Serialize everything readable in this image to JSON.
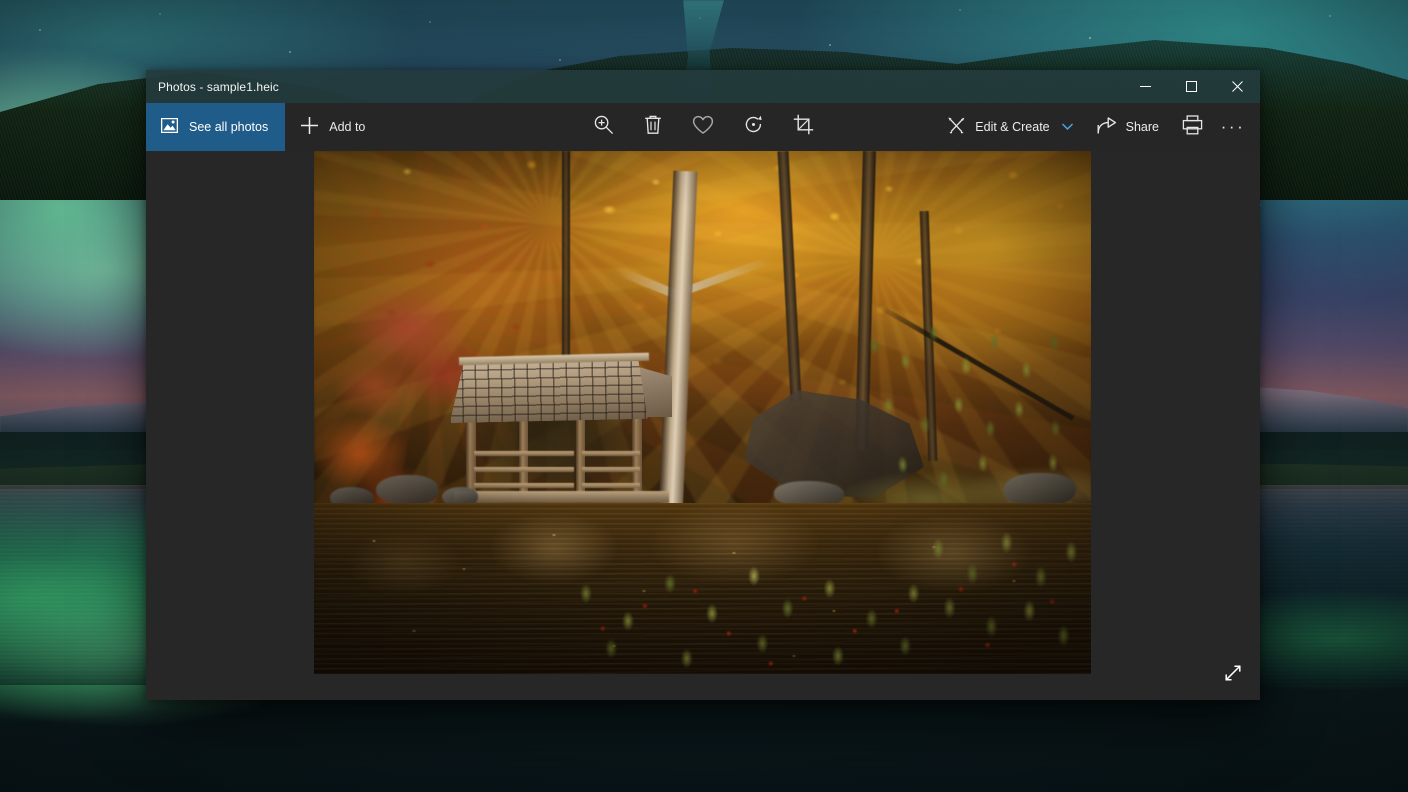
{
  "window": {
    "title": "Photos - sample1.heic",
    "app_name": "Photos",
    "file_name": "sample1.heic",
    "controls": {
      "minimize": "minimize-button",
      "maximize": "maximize-button",
      "close": "close-button"
    }
  },
  "toolbar": {
    "see_all_photos": "See all photos",
    "add_to": "Add to",
    "zoom": "Zoom",
    "delete": "Delete",
    "favorite": "Add to favorites",
    "rotate": "Rotate",
    "crop": "Crop & rotate",
    "edit_create": "Edit & Create",
    "share": "Share",
    "print": "Print",
    "more": "See more",
    "more_glyph": "···",
    "icons": {
      "see_all_photos": "photo-icon",
      "add_to": "plus-icon",
      "zoom": "magnifier-plus-icon",
      "delete": "trash-icon",
      "favorite": "heart-icon",
      "rotate": "rotate-icon",
      "crop": "crop-icon",
      "edit_create": "pen-brush-icon",
      "share": "share-arrow-icon",
      "print": "printer-icon",
      "chevron": "chevron-down-icon"
    }
  },
  "canvas": {
    "fullscreen_label": "View full screen",
    "fullscreen_icon": "diagonal-expand-arrows-icon",
    "photo_alt": "Autumn forest with wooden shelter beside a pond"
  },
  "desktop": {
    "wallpaper_alt": "Aurora borealis over a lake with snowy mountains"
  },
  "colors": {
    "accent_blue": "#1f5c8a",
    "chevron_blue": "#4aa3df",
    "toolbar_bg": "#262626",
    "canvas_bg": "#272727",
    "titlebar_bg": "#233a3c",
    "close_hover": "#e81123",
    "text_primary": "#f2f4f4"
  }
}
